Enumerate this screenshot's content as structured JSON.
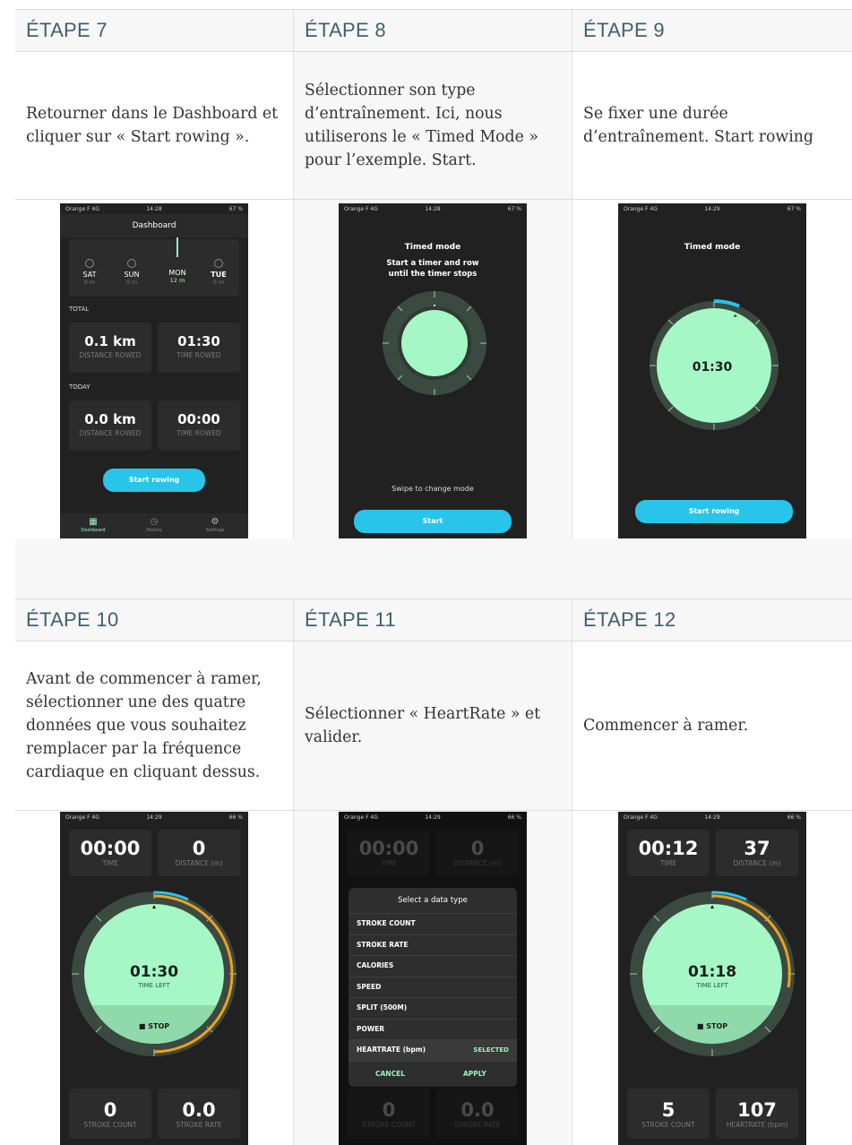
{
  "blocks": [
    {
      "steps": [
        {
          "header": "ÉTAPE 7",
          "desc": "Retourner dans le Dashboard et cliquer sur « Start rowing »."
        },
        {
          "header": "ÉTAPE 8",
          "desc": "Sélectionner son type d’entraînement. Ici, nous utiliserons le « Timed Mode » pour l’exemple. Start."
        },
        {
          "header": "ÉTAPE 9",
          "desc": "Se fixer une durée d’entraînement. Start rowing"
        }
      ]
    },
    {
      "steps": [
        {
          "header": "ÉTAPE 10",
          "desc": "Avant de commencer à ramer, sélectionner une des quatre données que vous souhaitez remplacer par la fréquence cardiaque en cliquant dessus."
        },
        {
          "header": "ÉTAPE 11",
          "desc": "Sélectionner « HeartRate » et valider."
        },
        {
          "header": "ÉTAPE 12",
          "desc": "Commencer à ramer."
        }
      ]
    }
  ],
  "screens": {
    "s7": {
      "status": {
        "carrier": "Orange F  4G",
        "time": "14:28",
        "battery": "67 %"
      },
      "title": "Dashboard",
      "days": [
        {
          "name": "SAT",
          "value": "0 m"
        },
        {
          "name": "SUN",
          "value": "0 m"
        },
        {
          "name": "MON",
          "value": "12 m"
        },
        {
          "name": "TUE",
          "value": "0 m"
        }
      ],
      "total_label": "TOTAL",
      "total": [
        {
          "value": "0.1 km",
          "label": "DISTANCE ROWED"
        },
        {
          "value": "01:30",
          "label": "TIME ROWED"
        }
      ],
      "today_label": "TODAY",
      "today": [
        {
          "value": "0.0 km",
          "label": "DISTANCE ROWED"
        },
        {
          "value": "00:00",
          "label": "TIME ROWED"
        }
      ],
      "button": "Start rowing",
      "nav": [
        "Dashboard",
        "History",
        "Settings"
      ]
    },
    "s8": {
      "status": {
        "carrier": "Orange F  4G",
        "time": "14:28",
        "battery": "67 %"
      },
      "title": "Timed mode",
      "subtitle1": "Start a timer and row",
      "subtitle2": "until the timer stops",
      "hint": "Swipe to change mode",
      "button": "Start"
    },
    "s9": {
      "status": {
        "carrier": "Orange F  4G",
        "time": "14:29",
        "battery": "67 %"
      },
      "title": "Timed mode",
      "time": "01:30",
      "button": "Start rowing"
    },
    "s10": {
      "status": {
        "carrier": "Orange F  4G",
        "time": "14:29",
        "battery": "66 %"
      },
      "top": [
        {
          "value": "00:00",
          "label": "TIME"
        },
        {
          "value": "0",
          "label": "DISTANCE (m)"
        }
      ],
      "time": "01:30",
      "time_label": "TIME LEFT",
      "stop": "■ STOP",
      "bottom": [
        {
          "value": "0",
          "label": "STROKE COUNT"
        },
        {
          "value": "0.0",
          "label": "STROKE RATE"
        }
      ]
    },
    "s11": {
      "status": {
        "carrier": "Orange F  4G",
        "time": "14:29",
        "battery": "66 %"
      },
      "top": [
        {
          "value": "00:00",
          "label": "TIME"
        },
        {
          "value": "0",
          "label": "DISTANCE (m)"
        }
      ],
      "dialog_title": "Select a data type",
      "items": [
        "STROKE COUNT",
        "STROKE RATE",
        "CALORIES",
        "SPEED",
        "SPLIT (500M)",
        "POWER",
        "HEARTRATE (bpm)"
      ],
      "selected": "SELECTED",
      "cancel": "CANCEL",
      "apply": "APPLY",
      "bottom": [
        {
          "value": "0",
          "label": "STROKE COUNT"
        },
        {
          "value": "0.0",
          "label": "STROKE RATE"
        }
      ]
    },
    "s12": {
      "status": {
        "carrier": "Orange F  4G",
        "time": "14:29",
        "battery": "66 %"
      },
      "top": [
        {
          "value": "00:12",
          "label": "TIME"
        },
        {
          "value": "37",
          "label": "DISTANCE (m)"
        }
      ],
      "time": "01:18",
      "time_label": "TIME LEFT",
      "stop": "■ STOP",
      "bottom": [
        {
          "value": "5",
          "label": "STROKE COUNT"
        },
        {
          "value": "107",
          "label": "HEARTRATE (bpm)"
        }
      ]
    }
  },
  "colors": {
    "accent": "#29c4ea",
    "ring_fill": "#a6f7c6",
    "progress": "#f0a020",
    "header": "#3f5f6e"
  }
}
